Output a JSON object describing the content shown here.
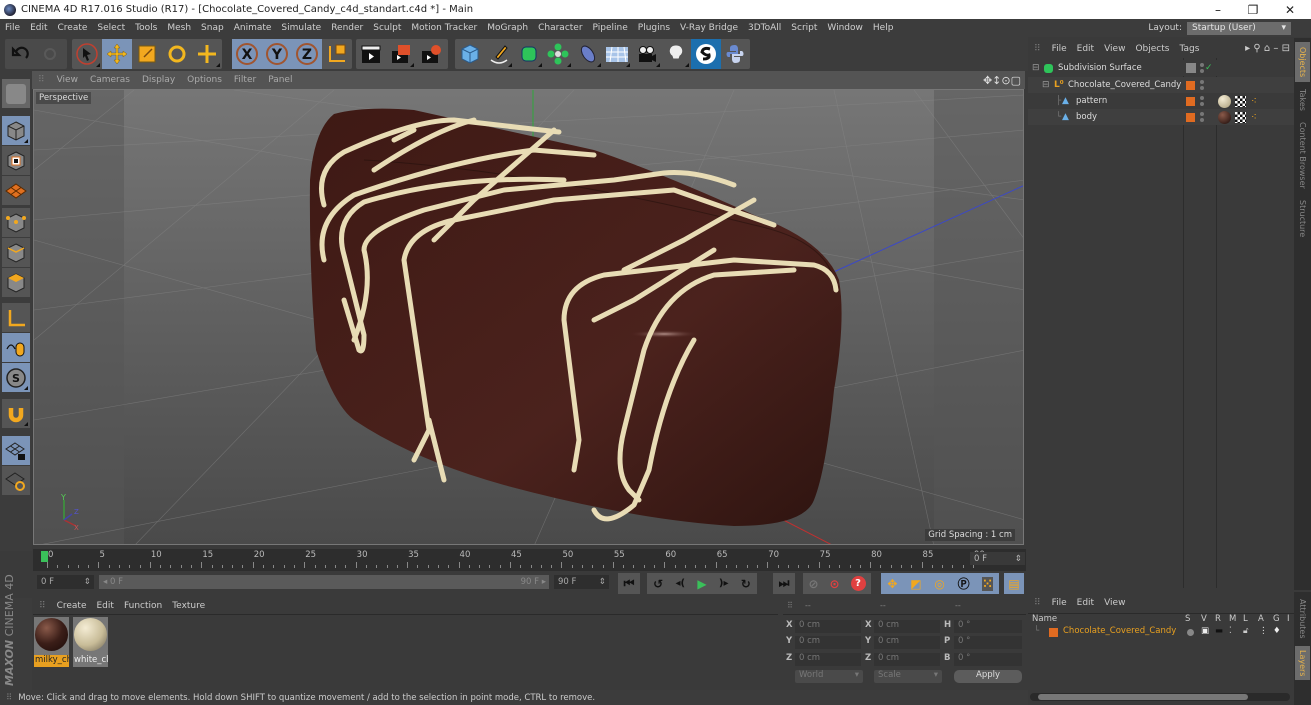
{
  "window": {
    "title": "CINEMA 4D R17.016 Studio (R17) - [Chocolate_Covered_Candy_c4d_standart.c4d *] - Main",
    "controls": {
      "minimize": "–",
      "restore": "❐",
      "close": "✕"
    }
  },
  "menubar": {
    "items": [
      "File",
      "Edit",
      "Create",
      "Select",
      "Tools",
      "Mesh",
      "Snap",
      "Animate",
      "Simulate",
      "Render",
      "Sculpt",
      "Motion Tracker",
      "MoGraph",
      "Character",
      "Pipeline",
      "Plugins",
      "V-Ray Bridge",
      "3DToAll",
      "Script",
      "Window",
      "Help"
    ],
    "layout_label": "Layout:",
    "layout_value": "Startup (User)"
  },
  "toolbar": {
    "undo": "undo-icon",
    "redo": "redo-icon",
    "modes": [
      "live-selection",
      "move",
      "scale",
      "rotate",
      "recent-tool"
    ],
    "axes": [
      "X",
      "Y",
      "Z"
    ],
    "coord_system": "world-coordinate-icon",
    "render": [
      "render-view",
      "render-picture-viewer",
      "edit-render-settings"
    ],
    "objects": [
      "cube",
      "pen-spline",
      "subdivision-surface",
      "cloner",
      "deformer",
      "floor",
      "camera",
      "light",
      "sketch",
      "python"
    ]
  },
  "left_toolbar": [
    "make-editable",
    "model-mode",
    "texture-mode",
    "workplane-mode",
    "points-mode",
    "edges-mode",
    "polygons-mode",
    "axis-mode",
    "tweak-mode",
    "solo-mode",
    "snap",
    "locked-workplane",
    "planar-workplane"
  ],
  "viewport": {
    "menu": [
      "View",
      "Cameras",
      "Display",
      "Options",
      "Filter",
      "Panel"
    ],
    "camera_label": "Perspective",
    "grid_spacing": "Grid Spacing : 1 cm",
    "axis_labels": {
      "y": "Y",
      "x": "X",
      "z": "Z"
    },
    "colors": {
      "chocolate": "#3d1a16",
      "chocolate_light": "#5a2823",
      "drizzle": "#e8dcb5",
      "floor": "#5e5e5e"
    }
  },
  "timeline": {
    "ticks": [
      "0",
      "5",
      "10",
      "15",
      "20",
      "25",
      "30",
      "35",
      "40",
      "45",
      "50",
      "55",
      "60",
      "65",
      "70",
      "75",
      "80",
      "85",
      "90"
    ],
    "current_frame": "0 F",
    "start_field": "0 F",
    "range_start": "0 F",
    "range_end": "90 F",
    "end_field": "90 F"
  },
  "transport": {
    "buttons": [
      "go-to-start",
      "previous-key",
      "previous-frame",
      "play-forward",
      "next-frame",
      "next-key",
      "go-to-end"
    ],
    "record": [
      "autokey-off",
      "record-active-objects",
      "autokeying"
    ],
    "key_tracks": [
      "move-track",
      "scale-track",
      "rotate-track",
      "param-track",
      "pla-track"
    ],
    "timeline_btn": "timeline-icon"
  },
  "material_manager": {
    "menu": [
      "Create",
      "Edit",
      "Function",
      "Texture"
    ],
    "materials": [
      {
        "name": "milky_ch",
        "color": "#3b1e18",
        "selected": true
      },
      {
        "name": "white_cl",
        "color": "#d4c8a8",
        "selected": false
      }
    ]
  },
  "coordinates": {
    "headers": [
      "--",
      "--",
      "--"
    ],
    "rows": [
      {
        "l1": "X",
        "v1": "0 cm",
        "l2": "X",
        "v2": "0 cm",
        "l3": "H",
        "v3": "0 °"
      },
      {
        "l1": "Y",
        "v1": "0 cm",
        "l2": "Y",
        "v2": "0 cm",
        "l3": "P",
        "v3": "0 °"
      },
      {
        "l1": "Z",
        "v1": "0 cm",
        "l2": "Z",
        "v2": "0 cm",
        "l3": "B",
        "v3": "0 °"
      }
    ],
    "mode_select": "World",
    "size_select": "Scale",
    "apply_label": "Apply"
  },
  "object_manager": {
    "menu": [
      "File",
      "Edit",
      "View",
      "Objects",
      "Tags"
    ],
    "objects": [
      {
        "name": "Subdivision Surface",
        "indent": 0,
        "icon": "subdivision-icon"
      },
      {
        "name": "Chocolate_Covered_Candy",
        "indent": 1,
        "icon": "null-object-icon"
      },
      {
        "name": "pattern",
        "indent": 2,
        "icon": "polygon-object-icon",
        "material": "#d4c8a8"
      },
      {
        "name": "body",
        "indent": 2,
        "icon": "polygon-object-icon",
        "material": "#3b1e18"
      }
    ]
  },
  "side_tabs": [
    "Objects",
    "Takes",
    "Content Browser",
    "Structure"
  ],
  "layer_manager": {
    "menu": [
      "File",
      "Edit",
      "View"
    ],
    "columns": [
      "Name",
      "S",
      "V",
      "R",
      "M",
      "L",
      "A",
      "G",
      "I"
    ],
    "layers": [
      {
        "name": "Chocolate_Covered_Candy",
        "color": "#e06b21"
      }
    ]
  },
  "side_tabs_bottom": [
    "Attributes",
    "Layers"
  ],
  "status": {
    "message": "Move: Click and drag to move elements. Hold down SHIFT to quantize movement / add to the selection in point mode, CTRL to remove."
  },
  "branding": {
    "maxon": "MAXON",
    "product": "CINEMA 4D"
  }
}
